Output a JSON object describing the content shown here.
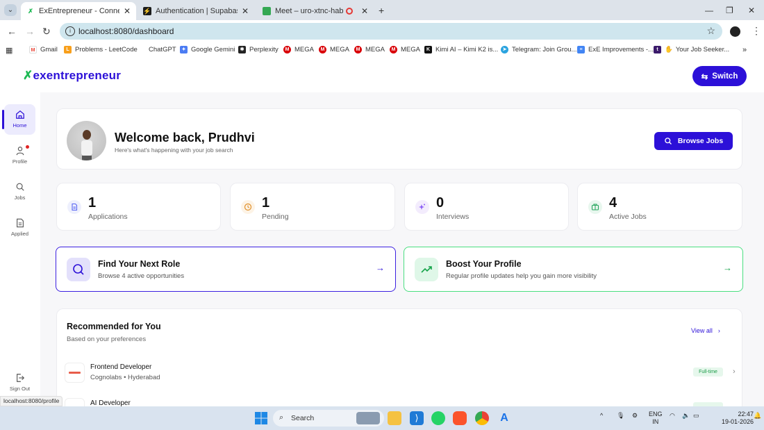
{
  "browser": {
    "tabs": [
      {
        "title": "ExEntrepreneur - Connect Exite",
        "active": true
      },
      {
        "title": "Authentication | Supabase",
        "active": false
      },
      {
        "title": "Meet – uro-xtnc-hab",
        "active": false
      }
    ],
    "url": "localhost:8080/dashboard",
    "bookmarks": [
      "Gmail",
      "Problems - LeetCode",
      "ChatGPT",
      "Google Gemini",
      "Perplexity",
      "MEGA",
      "MEGA",
      "MEGA",
      "MEGA",
      "Kimi AI – Kimi K2 is...",
      "Telegram: Join Grou...",
      "ExE Improvements -...",
      "Your Job Seeker..."
    ],
    "status_url": "localhost:8080/profile"
  },
  "app": {
    "brand": "exentrepreneur",
    "switch_label": "Switch",
    "sidebar": [
      {
        "label": "Home",
        "icon": "home-icon"
      },
      {
        "label": "Profile",
        "icon": "user-icon"
      },
      {
        "label": "Jobs",
        "icon": "search-icon"
      },
      {
        "label": "Applied",
        "icon": "document-icon"
      }
    ],
    "sign_out": "Sign Out",
    "welcome": {
      "title": "Welcome back, Prudhvi",
      "subtitle": "Here's what's happening with your job search",
      "browse_label": "Browse Jobs"
    },
    "stats": [
      {
        "value": "1",
        "label": "Applications",
        "color": "#eef0fd"
      },
      {
        "value": "1",
        "label": "Pending",
        "color": "#fdf3e6"
      },
      {
        "value": "0",
        "label": "Interviews",
        "color": "#f3ecfd"
      },
      {
        "value": "4",
        "label": "Active Jobs",
        "color": "#e8f7ee"
      }
    ],
    "actions": [
      {
        "title": "Find Your Next Role",
        "subtitle": "Browse 4 active opportunities"
      },
      {
        "title": "Boost Your Profile",
        "subtitle": "Regular profile updates help you gain more visibility"
      }
    ],
    "recommended": {
      "title": "Recommended for You",
      "subtitle": "Based on your preferences",
      "view_all": "View all",
      "jobs": [
        {
          "title": "Frontend Developer",
          "company": "Cognolabs",
          "location": "Hyderabad",
          "type": "Full-time"
        },
        {
          "title": "AI Developer",
          "company": "",
          "location": "",
          "type": ""
        }
      ]
    }
  },
  "taskbar": {
    "search": "Search",
    "lang": "ENG",
    "region": "IN",
    "time": "22:47",
    "date": "19-01-2026"
  }
}
